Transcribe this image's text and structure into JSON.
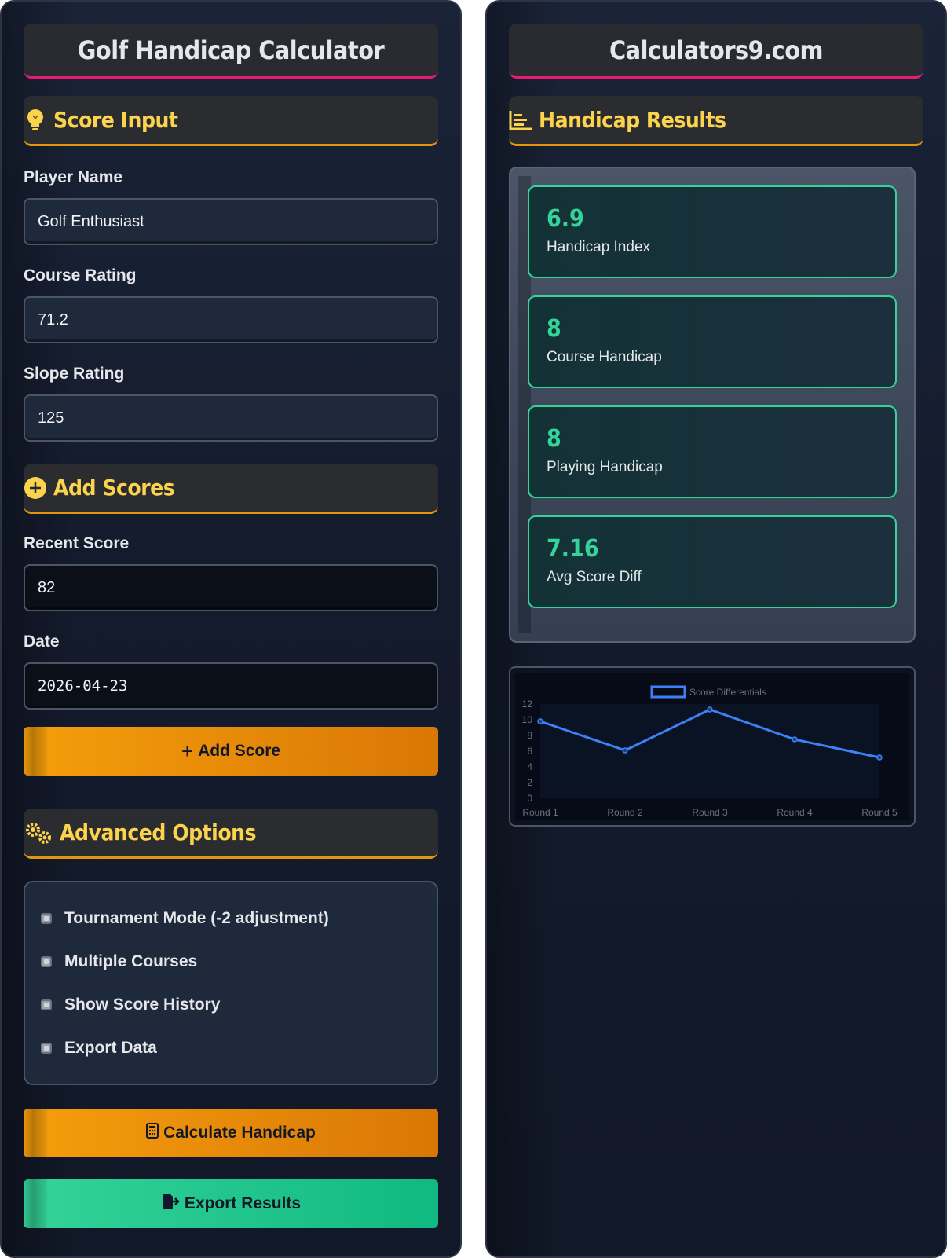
{
  "left": {
    "title": "Golf Handicap Calculator",
    "score_input": {
      "heading": "Score Input",
      "player_name_label": "Player Name",
      "player_name_value": "Golf Enthusiast",
      "course_rating_label": "Course Rating",
      "course_rating_value": "71.2",
      "slope_rating_label": "Slope Rating",
      "slope_rating_value": "125"
    },
    "add_scores": {
      "heading": "Add Scores",
      "recent_score_label": "Recent Score",
      "recent_score_value": "82",
      "date_label": "Date",
      "date_value": "2026-04-23",
      "add_button": "Add Score"
    },
    "advanced": {
      "heading": "Advanced Options",
      "options": [
        "Tournament Mode (-2 adjustment)",
        "Multiple Courses",
        "Show Score History",
        "Export Data"
      ]
    },
    "calculate_button": "Calculate Handicap",
    "export_button": "Export Results"
  },
  "right": {
    "title": "Calculators9.com",
    "results_heading": "Handicap Results",
    "results": [
      {
        "value": "6.9",
        "label": "Handicap Index"
      },
      {
        "value": "8",
        "label": "Course Handicap"
      },
      {
        "value": "8",
        "label": "Playing Handicap"
      },
      {
        "value": "7.16",
        "label": "Avg Score Diff"
      }
    ]
  },
  "colors": {
    "accent_gold": "#fcd34d",
    "accent_orange": "#f59e0b",
    "accent_green": "#34d399",
    "title_underline": "#e11d74",
    "chart_line": "#3b82f6"
  },
  "chart_data": {
    "type": "line",
    "categories": [
      "Round 1",
      "Round 2",
      "Round 3",
      "Round 4",
      "Round 5"
    ],
    "series": [
      {
        "name": "Score Differentials",
        "values": [
          9.8,
          6.1,
          11.3,
          7.5,
          5.2
        ]
      }
    ],
    "ylim": [
      0,
      12
    ],
    "yticks": [
      "0",
      "2",
      "4",
      "6",
      "8",
      "10",
      "12"
    ],
    "legend": "top"
  }
}
